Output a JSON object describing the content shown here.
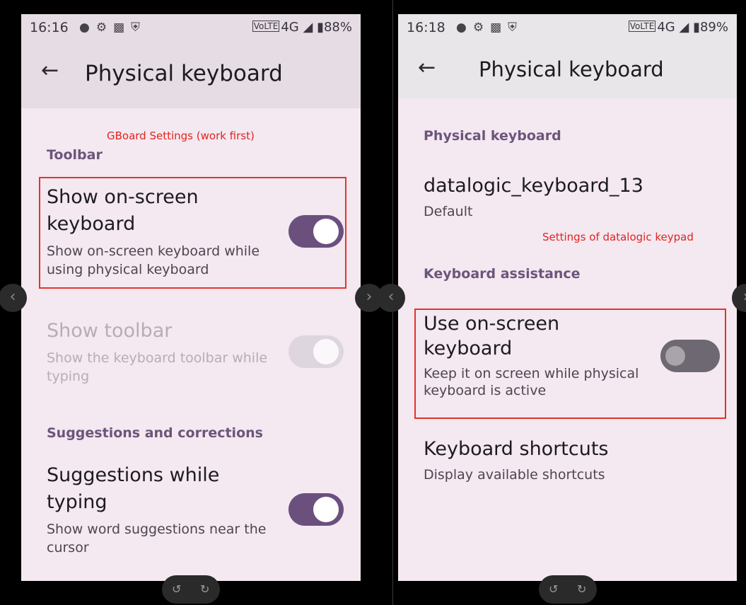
{
  "left": {
    "status": {
      "time": "16:16",
      "network": "VoLTE",
      "signal": "4G",
      "battery": "88%"
    },
    "header": {
      "title": "Physical keyboard"
    },
    "annotation": "GBoard Settings (work first)",
    "sections": {
      "toolbar": "Toolbar",
      "suggestions": "Suggestions and corrections"
    },
    "items": {
      "show_onscreen": {
        "title": "Show on-screen keyboard",
        "summary": "Show on-screen keyboard while using physical keyboard",
        "enabled": true
      },
      "show_toolbar": {
        "title": "Show toolbar",
        "summary": "Show the keyboard toolbar while typing",
        "enabled": true,
        "disabled": true
      },
      "suggestions": {
        "title": "Suggestions while typing",
        "summary": "Show word suggestions near the cursor",
        "enabled": true
      }
    }
  },
  "right": {
    "status": {
      "time": "16:18",
      "network": "VoLTE",
      "signal": "4G",
      "battery": "89%"
    },
    "header": {
      "title": "Physical keyboard"
    },
    "annotation": "Settings of datalogic keypad",
    "sections": {
      "physical": "Physical keyboard",
      "assistance": "Keyboard assistance"
    },
    "items": {
      "device": {
        "title": "datalogic_keyboard_13",
        "summary": "Default"
      },
      "use_onscreen": {
        "title": "Use on-screen keyboard",
        "summary": "Keep it on screen while physical keyboard is active",
        "enabled": false
      },
      "shortcuts": {
        "title": "Keyboard shortcuts",
        "summary": "Display available shortcuts"
      }
    }
  },
  "colors": {
    "accent": "#6b507e",
    "section": "#6c557a",
    "annotation": "#e0251e"
  }
}
